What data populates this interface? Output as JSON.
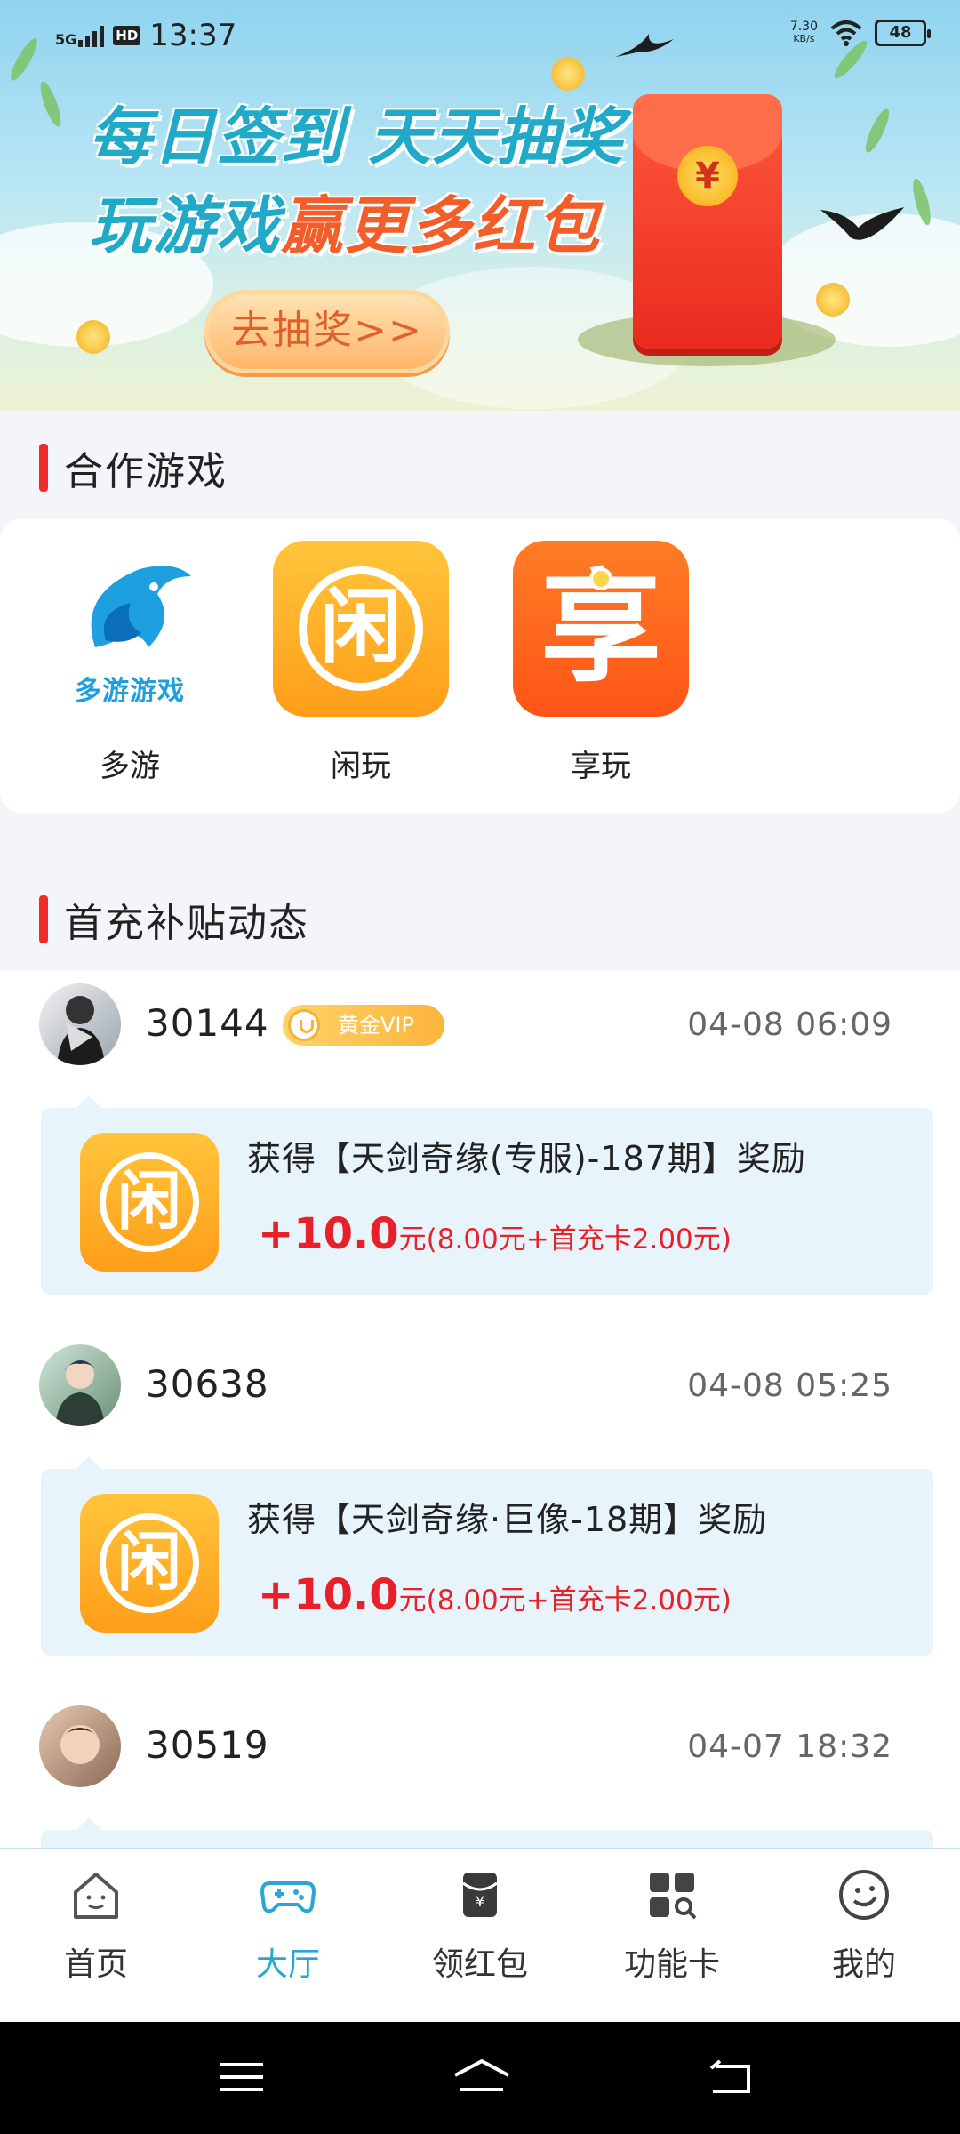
{
  "status_bar": {
    "network": "5G",
    "hd": "HD",
    "time": "13:37",
    "speed_value": "7.30",
    "speed_unit": "KB/s",
    "battery": "48"
  },
  "banner": {
    "line1": "每日签到 天天抽奖",
    "line2_a": "玩游戏",
    "line2_b": "赢更多红包",
    "button": "去抽奖>>",
    "envelope_symbol": "¥"
  },
  "partner_section": {
    "title": "合作游戏",
    "games": [
      {
        "name": "多游",
        "icon_text": "多游游戏",
        "icon": "dolphin-icon"
      },
      {
        "name": "闲玩",
        "icon_text": "闲",
        "icon": "xianwan-icon"
      },
      {
        "name": "享玩",
        "icon_text": "享",
        "icon": "xiangwan-icon"
      }
    ]
  },
  "feed_section": {
    "title": "首充补贴动态",
    "entries": [
      {
        "user_id": "30144",
        "vip": "黄金VIP",
        "time": "04-08 06:09",
        "title": "获得【天剑奇缘(专服)-187期】奖励",
        "amount": "+10.0",
        "detail": "元(8.00元+首充卡2.00元)"
      },
      {
        "user_id": "30638",
        "time": "04-08 05:25",
        "title": "获得【天剑奇缘·巨像-18期】奖励",
        "amount": "+10.0",
        "detail": "元(8.00元+首充卡2.00元)"
      },
      {
        "user_id": "30519",
        "time": "04-07 18:32"
      }
    ]
  },
  "tabbar": {
    "active": "大厅",
    "tabs": [
      {
        "label": "首页",
        "icon": "home-icon"
      },
      {
        "label": "大厅",
        "icon": "gamepad-icon"
      },
      {
        "label": "领红包",
        "icon": "red-envelope-icon"
      },
      {
        "label": "功能卡",
        "icon": "apps-search-icon"
      },
      {
        "label": "我的",
        "icon": "smiley-icon"
      }
    ],
    "active_color": "#2aa6d6"
  },
  "colors": {
    "accent_red": "#ee2a2a",
    "reward_red": "#e8202a",
    "card_bg": "#e8f4fb"
  }
}
